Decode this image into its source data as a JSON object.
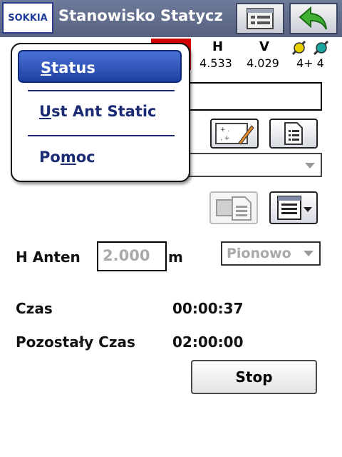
{
  "app": {
    "logo_text": "SOKKIA",
    "title": "Stanowisko Statycz",
    "icons": {
      "left_button": "list-window-icon",
      "right_button": "back-arrow-icon"
    }
  },
  "status_strip": {
    "h_label": "H",
    "h_value": "4.533",
    "v_label": "V",
    "v_value": "4.029",
    "sat_value": "4+ 4",
    "icons": [
      "satellite-icon-yellow",
      "satellite-icon-teal"
    ]
  },
  "form": {
    "antenna_label": "H Anten",
    "antenna_value": "2.000",
    "antenna_unit": "m",
    "measure_mode": "Pionowo",
    "time_label": "Czas",
    "time_value": "00:00:37",
    "remaining_label": "Pozostały Czas",
    "remaining_value": "02:00:00",
    "stop_label": "Stop"
  },
  "menu": {
    "status": {
      "first": "S",
      "rest": "tatus"
    },
    "antenna_settings": {
      "first": "U",
      "rest": "st Ant Static"
    },
    "help": {
      "pre": "Po",
      "ul": "m",
      "post": "oc"
    }
  },
  "colors": {
    "titlebar": "#5e6a88",
    "menu_highlight": "#2e52bf",
    "menu_text": "#1c2c74",
    "status_red": "#d40000"
  }
}
